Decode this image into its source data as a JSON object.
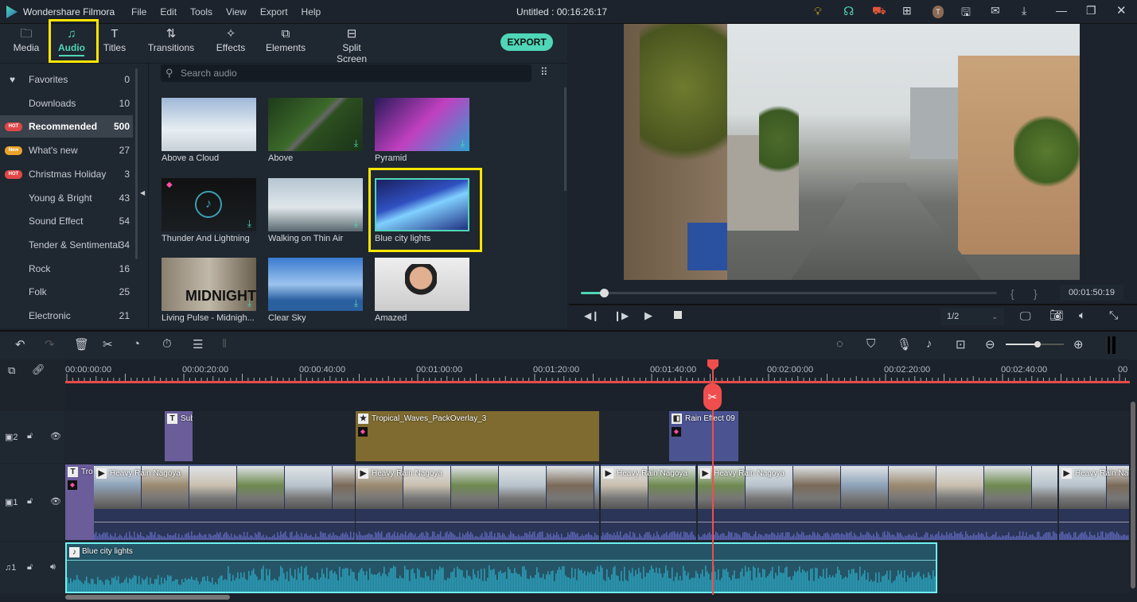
{
  "app": {
    "name": "Wondershare Filmora",
    "title": "Untitled : 00:16:26:17",
    "menu": [
      "File",
      "Edit",
      "Tools",
      "View",
      "Export",
      "Help"
    ],
    "title_icons": [
      "bulb-icon",
      "headset-icon",
      "cart-icon",
      "gift-icon",
      "avatar",
      "save-icon",
      "mail-icon",
      "download-icon",
      "minimize-icon",
      "restore-icon",
      "close-icon"
    ],
    "avatar_letter": "T"
  },
  "tabs": [
    {
      "label": "Media",
      "icon": "folder-icon"
    },
    {
      "label": "Audio",
      "icon": "music-icon",
      "active": true
    },
    {
      "label": "Titles",
      "icon": "text-icon"
    },
    {
      "label": "Transitions",
      "icon": "transitions-icon"
    },
    {
      "label": "Effects",
      "icon": "effects-icon"
    },
    {
      "label": "Elements",
      "icon": "elements-icon"
    },
    {
      "label": "Split Screen",
      "icon": "split-screen-icon"
    }
  ],
  "export_label": "EXPORT",
  "search": {
    "placeholder": "Search audio"
  },
  "sidebar": [
    {
      "label": "Favorites",
      "count": "0",
      "icon": "heart-icon"
    },
    {
      "label": "Downloads",
      "count": "10"
    },
    {
      "label": "Recommended",
      "count": "500",
      "badge": "HOT",
      "selected": true
    },
    {
      "label": "What's new",
      "count": "27",
      "badge": "New"
    },
    {
      "label": "Christmas Holiday",
      "count": "3",
      "badge": "HOT"
    },
    {
      "label": "Young & Bright",
      "count": "43"
    },
    {
      "label": "Sound Effect",
      "count": "54"
    },
    {
      "label": "Tender & Sentimental",
      "count": "34"
    },
    {
      "label": "Rock",
      "count": "16"
    },
    {
      "label": "Folk",
      "count": "25"
    },
    {
      "label": "Electronic",
      "count": "21"
    }
  ],
  "library": [
    {
      "title": "Above a Cloud"
    },
    {
      "title": "Above",
      "download": true
    },
    {
      "title": "Pyramid",
      "download": true
    },
    {
      "title": "Thunder And Lightning",
      "download": true,
      "premium": true
    },
    {
      "title": "Walking on Thin Air",
      "download": true
    },
    {
      "title": "Blue city lights",
      "selected": true
    },
    {
      "title": "Living Pulse - Midnigh...",
      "thumb_text": "MIDNIGHT",
      "download": true
    },
    {
      "title": "Clear Sky",
      "download": true
    },
    {
      "title": "Amazed"
    }
  ],
  "player": {
    "timecode": "00:01:50:19",
    "progress": 0.055,
    "quality": "1/2",
    "mark_in": "{",
    "mark_out": "}"
  },
  "timeline": {
    "ruler": [
      "00:00:00:00",
      "00:00:20:00",
      "00:00:40:00",
      "00:01:00:00",
      "00:01:20:00",
      "00:01:40:00",
      "00:02:00:00",
      "00:02:20:00",
      "00:02:40:00",
      "00"
    ],
    "zoom_level": 0.55,
    "tracks": [
      {
        "label": "2",
        "type": "video"
      },
      {
        "label": "1",
        "type": "video"
      },
      {
        "label": "1",
        "type": "audio"
      }
    ],
    "clips_v2": [
      {
        "label": "Sub",
        "type": "title"
      },
      {
        "label": "Tropical_Waves_PackOverlay_3",
        "type": "element"
      },
      {
        "label": "Rain Effect 09",
        "type": "overlay"
      }
    ],
    "clips_v1": [
      {
        "label": "Tro",
        "type": "title"
      },
      {
        "label": "Heavy Rain Nagoya"
      },
      {
        "label": "Heavy Rain Nagoya"
      },
      {
        "label": "Heavy Rain Nagoya"
      },
      {
        "label": "Heavy Rain Nagoya"
      },
      {
        "label": "Heavy Rain Nag"
      }
    ],
    "clips_a1": [
      {
        "label": "Blue city lights"
      }
    ]
  },
  "colors": {
    "accent": "#4fd6b8",
    "playhead": "#f04e4e",
    "highlight": "#ffe600",
    "audio_clip": "#2b8fa6"
  }
}
